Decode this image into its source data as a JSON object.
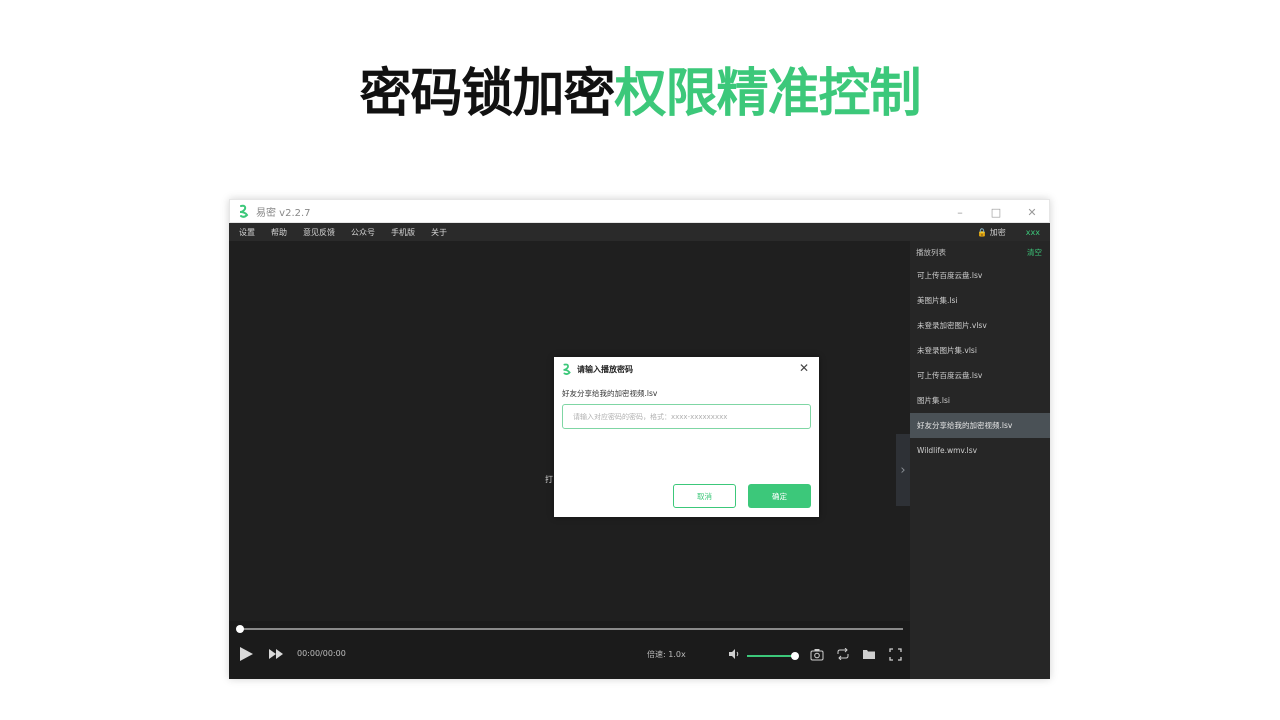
{
  "headline": {
    "part_black": "密码锁加密",
    "part_green": "权限精准控制"
  },
  "window": {
    "title": "易密 v2.2.7"
  },
  "menu": {
    "items": [
      "设置",
      "帮助",
      "意见反馈",
      "公众号",
      "手机版",
      "关于"
    ],
    "lock_label": "加密",
    "user_label": "xxx"
  },
  "player": {
    "hint_text": "打",
    "time": "00:00/00:00",
    "speed": "倍速: 1.0x",
    "progress_fraction": 0,
    "volume_fraction": 1
  },
  "playlist": {
    "title": "播放列表",
    "clear_label": "清空",
    "items": [
      "可上传百度云盘.lsv",
      "美图片集.lsi",
      "未登录加密图片.vlsv",
      "未登录图片集.vlsi",
      "可上传百度云盘.lsv",
      "图片集.lsi",
      "好友分享给我的加密视频.lsv",
      "Wildlife.wmv.lsv"
    ],
    "active_index": 6
  },
  "dialog": {
    "title": "请输入播放密码",
    "file_name": "好友分享给我的加密视频.lsv",
    "input_placeholder": "请输入对应密码的密码，格式：xxxx-xxxxxxxxx",
    "input_value": "",
    "cancel_label": "取消",
    "ok_label": "确定"
  },
  "colors": {
    "accent": "#3cc87a",
    "player_bg": "#1f1f1f",
    "playlist_bg": "#262626",
    "active_item_bg": "#4a5156"
  }
}
